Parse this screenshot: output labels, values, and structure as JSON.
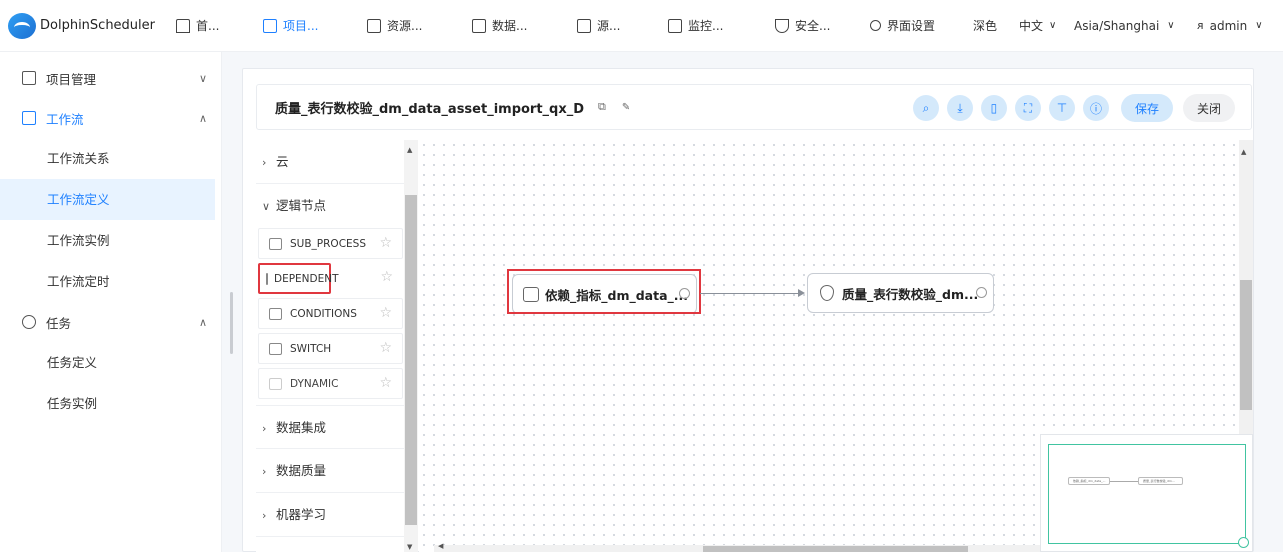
{
  "app": {
    "name": "DolphinScheduler"
  },
  "nav": {
    "items": [
      {
        "label": "首..."
      },
      {
        "label": "项目..."
      },
      {
        "label": "资源..."
      },
      {
        "label": "数据..."
      },
      {
        "label": "源..."
      },
      {
        "label": "监控..."
      },
      {
        "label": "安全..."
      },
      {
        "label": "界面设置"
      }
    ],
    "theme": "深色",
    "language": "中文",
    "timezone": "Asia/Shanghai",
    "user": "admin",
    "accent_color": "#1e80ff"
  },
  "sidebar": {
    "project_mgmt": "项目管理",
    "workflow": "工作流",
    "workflow_items": [
      "工作流关系",
      "工作流定义",
      "工作流实例",
      "工作流定时"
    ],
    "task": "任务",
    "task_items": [
      "任务定义",
      "任务实例"
    ]
  },
  "toolbar": {
    "title": "质量_表行数校验_dm_data_asset_import_qx_D",
    "save": "保存",
    "close": "关闭",
    "icons": [
      "search-icon",
      "download-icon",
      "delete-icon",
      "fullscreen-icon",
      "format-icon",
      "info-icon"
    ]
  },
  "palette": {
    "cloud": "云",
    "logic": "逻辑节点",
    "nodes": [
      "SUB_PROCESS",
      "DEPENDENT",
      "CONDITIONS",
      "SWITCH",
      "DYNAMIC"
    ],
    "data_integration": "数据集成",
    "data_quality": "数据质量",
    "ml": "机器学习"
  },
  "dag": {
    "node1": "依赖_指标_dm_data_...",
    "node2": "质量_表行数校验_dm...",
    "highlight_color": "#e0373f"
  },
  "minimap": {
    "node1": "依赖_指标_dm_data_...",
    "node2": "质量_表行数校验_dm...",
    "border_color": "#41c4a1"
  }
}
